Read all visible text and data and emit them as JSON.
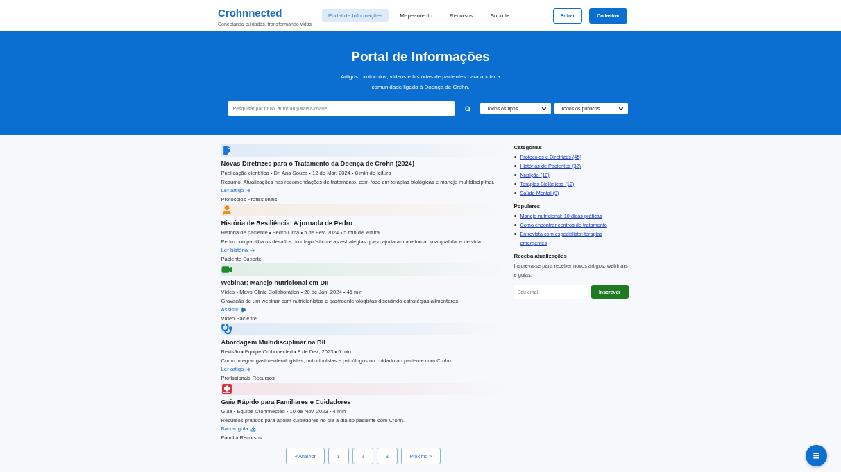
{
  "header": {
    "logo": "Crohnnected",
    "tagline": "Conectando cuidados, transformando vidas",
    "nav": [
      {
        "label": "Portal de Informações",
        "selected": true
      },
      {
        "label": "Mapeamento",
        "selected": false
      },
      {
        "label": "Recursos",
        "selected": false
      },
      {
        "label": "Suporte",
        "selected": false
      }
    ],
    "login": "Entrar",
    "signup": "Cadastrar"
  },
  "hero": {
    "title": "Portal de Informações",
    "subtitle": "Artigos, protocolos, vídeos e histórias de pacientes para apoiar a comunidade ligada à Doença de Crohn.",
    "search_placeholder": "Pesquisar por título, autor ou palavra-chave",
    "type_filter": "Todos os tipos",
    "audience_filter": "Todos os públicos"
  },
  "articles": [
    {
      "kind": "document",
      "color": "#1a73d6",
      "title": "Novas Diretrizes para o Tratamento da Doença de Crohn (2024)",
      "meta": "Publicação científica • Dr. Ana Souza • 12 de Mar, 2024 • 8 min de leitura",
      "summary": "Resumo: Atualizações nas recomendações de tratamento, com foco em terapias biológicas e manejo multidisciplinar.",
      "link": {
        "label": "Ler artigo",
        "kind": "arrow"
      },
      "tags": "Protocolos Profissionais"
    },
    {
      "kind": "person",
      "color": "#f08a1c",
      "title": "História de Resiliência: A jornada de Pedro",
      "meta": "História de paciente • Pedro Lima • 5 de Fev, 2024 • 5 min de leitura",
      "summary": "Pedro compartilha os desafios do diagnóstico e as estratégias que o ajudaram a retomar sua qualidade de vida.",
      "link": {
        "label": "Ler história",
        "kind": "arrow"
      },
      "tags": "Paciente Suporte"
    },
    {
      "kind": "video",
      "color": "#1e8a2a",
      "title": "Webinar: Manejo nutricional em DII",
      "meta": "Vídeo • Mayo Clinic Collaboration • 20 de Jan, 2024 • 45 min",
      "summary": "Gravação de um webinar com nutricionistas e gastroenterologistas discutindo estratégias alimentares.",
      "link": {
        "label": "Assistir",
        "kind": "play"
      },
      "tags": "Vídeo Paciente"
    },
    {
      "kind": "stethoscope",
      "color": "#1a73d6",
      "title": "Abordagem Multidisciplinar na DII",
      "meta": "Revisão • Equipe Crohnnected • 8 de Dez, 2023 • 6 min",
      "summary": "Como integrar gastroenterologistas, nutricionistas e psicólogos no cuidado ao paciente com Crohn.",
      "link": {
        "label": "Ler artigo",
        "kind": "arrow"
      },
      "tags": "Profissionais Recursos"
    },
    {
      "kind": "medkit",
      "color": "#d9333f",
      "title": "Guia Rápido para Familiares e Cuidadores",
      "meta": "Guia • Equipe Crohnnected • 10 de Nov, 2023 • 4 min",
      "summary": "Recursos práticos para apoiar cuidadores no dia a dia do paciente com Crohn.",
      "link": {
        "label": "Baixar guia",
        "kind": "download"
      },
      "tags": "Família Recursos"
    }
  ],
  "pagination": {
    "previous": "« Anterior",
    "pages": [
      "1",
      "2",
      "3"
    ],
    "next": "Próximo »"
  },
  "sidebar": {
    "categories_title": "Categorias",
    "categories": [
      "Protocolos e Diretrizes (45)",
      "Histórias de Pacientes (32)",
      "Nutrição (18)",
      "Terapias Biológicas (12)",
      "Saúde Mental (9)"
    ],
    "popular_title": "Populares",
    "popular": [
      "Manejo nutricional: 10 dicas práticas",
      "Como encontrar centros de tratamento",
      "Entrevista com especialista: terapias emergentes"
    ],
    "newsletter_title": "Receba atualizações",
    "newsletter_text": "Inscreva-se para receber novos artigos, webinars e guias.",
    "email_placeholder": "Seu email",
    "subscribe": "Inscrever"
  }
}
